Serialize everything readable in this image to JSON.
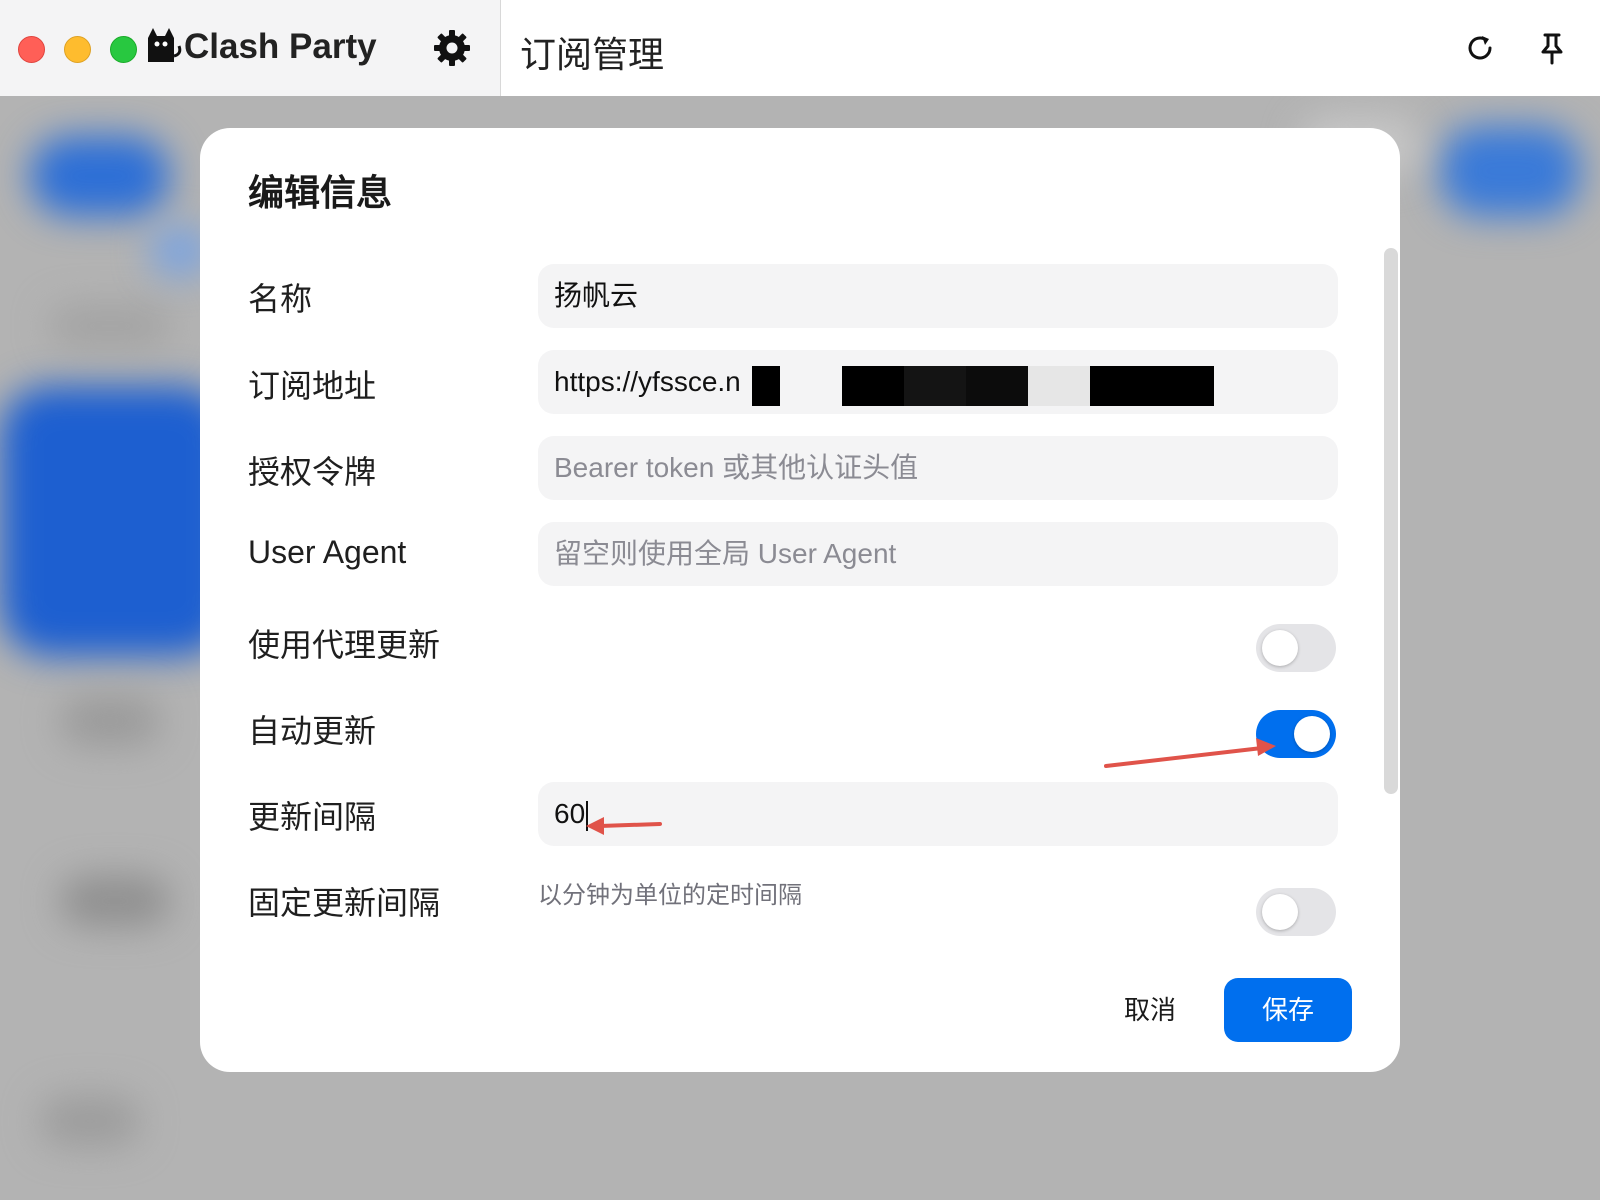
{
  "app": {
    "name": "Clash Party",
    "page_title": "订阅管理"
  },
  "modal": {
    "title": "编辑信息",
    "fields": {
      "name": {
        "label": "名称",
        "value": "扬帆云"
      },
      "url": {
        "label": "订阅地址",
        "value": "https://yfssce.n"
      },
      "auth": {
        "label": "授权令牌",
        "placeholder": "Bearer token 或其他认证头值"
      },
      "user_agent": {
        "label": "User Agent",
        "placeholder": "留空则使用全局 User Agent"
      },
      "use_proxy": {
        "label": "使用代理更新",
        "enabled": false
      },
      "auto_update": {
        "label": "自动更新",
        "enabled": true
      },
      "interval": {
        "label": "更新间隔",
        "value": "60",
        "hint": "以分钟为单位的定时间隔"
      },
      "fixed_interval": {
        "label": "固定更新间隔",
        "enabled": false
      }
    },
    "buttons": {
      "cancel": "取消",
      "save": "保存"
    }
  },
  "colors": {
    "accent": "#006fee",
    "annotation_arrow": "#e0534a",
    "toggle_off": "#e4e4e7"
  },
  "icons": [
    "cat-logo-icon",
    "gear-icon",
    "refresh-icon",
    "pin-icon"
  ]
}
